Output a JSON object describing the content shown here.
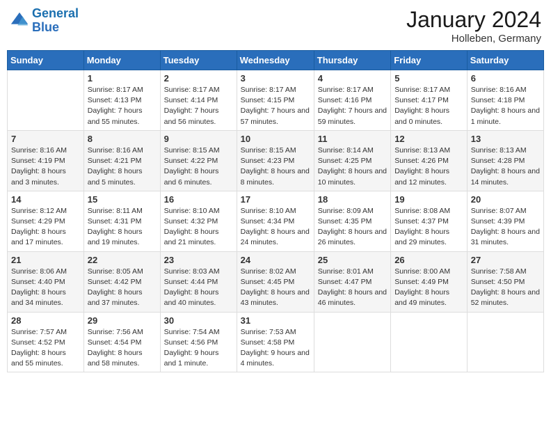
{
  "header": {
    "logo_general": "General",
    "logo_blue": "Blue",
    "month": "January 2024",
    "location": "Holleben, Germany"
  },
  "days_of_week": [
    "Sunday",
    "Monday",
    "Tuesday",
    "Wednesday",
    "Thursday",
    "Friday",
    "Saturday"
  ],
  "weeks": [
    [
      {
        "day": "",
        "sunrise": "",
        "sunset": "",
        "daylight": ""
      },
      {
        "day": "1",
        "sunrise": "Sunrise: 8:17 AM",
        "sunset": "Sunset: 4:13 PM",
        "daylight": "Daylight: 7 hours and 55 minutes."
      },
      {
        "day": "2",
        "sunrise": "Sunrise: 8:17 AM",
        "sunset": "Sunset: 4:14 PM",
        "daylight": "Daylight: 7 hours and 56 minutes."
      },
      {
        "day": "3",
        "sunrise": "Sunrise: 8:17 AM",
        "sunset": "Sunset: 4:15 PM",
        "daylight": "Daylight: 7 hours and 57 minutes."
      },
      {
        "day": "4",
        "sunrise": "Sunrise: 8:17 AM",
        "sunset": "Sunset: 4:16 PM",
        "daylight": "Daylight: 7 hours and 59 minutes."
      },
      {
        "day": "5",
        "sunrise": "Sunrise: 8:17 AM",
        "sunset": "Sunset: 4:17 PM",
        "daylight": "Daylight: 8 hours and 0 minutes."
      },
      {
        "day": "6",
        "sunrise": "Sunrise: 8:16 AM",
        "sunset": "Sunset: 4:18 PM",
        "daylight": "Daylight: 8 hours and 1 minute."
      }
    ],
    [
      {
        "day": "7",
        "sunrise": "Sunrise: 8:16 AM",
        "sunset": "Sunset: 4:19 PM",
        "daylight": "Daylight: 8 hours and 3 minutes."
      },
      {
        "day": "8",
        "sunrise": "Sunrise: 8:16 AM",
        "sunset": "Sunset: 4:21 PM",
        "daylight": "Daylight: 8 hours and 5 minutes."
      },
      {
        "day": "9",
        "sunrise": "Sunrise: 8:15 AM",
        "sunset": "Sunset: 4:22 PM",
        "daylight": "Daylight: 8 hours and 6 minutes."
      },
      {
        "day": "10",
        "sunrise": "Sunrise: 8:15 AM",
        "sunset": "Sunset: 4:23 PM",
        "daylight": "Daylight: 8 hours and 8 minutes."
      },
      {
        "day": "11",
        "sunrise": "Sunrise: 8:14 AM",
        "sunset": "Sunset: 4:25 PM",
        "daylight": "Daylight: 8 hours and 10 minutes."
      },
      {
        "day": "12",
        "sunrise": "Sunrise: 8:13 AM",
        "sunset": "Sunset: 4:26 PM",
        "daylight": "Daylight: 8 hours and 12 minutes."
      },
      {
        "day": "13",
        "sunrise": "Sunrise: 8:13 AM",
        "sunset": "Sunset: 4:28 PM",
        "daylight": "Daylight: 8 hours and 14 minutes."
      }
    ],
    [
      {
        "day": "14",
        "sunrise": "Sunrise: 8:12 AM",
        "sunset": "Sunset: 4:29 PM",
        "daylight": "Daylight: 8 hours and 17 minutes."
      },
      {
        "day": "15",
        "sunrise": "Sunrise: 8:11 AM",
        "sunset": "Sunset: 4:31 PM",
        "daylight": "Daylight: 8 hours and 19 minutes."
      },
      {
        "day": "16",
        "sunrise": "Sunrise: 8:10 AM",
        "sunset": "Sunset: 4:32 PM",
        "daylight": "Daylight: 8 hours and 21 minutes."
      },
      {
        "day": "17",
        "sunrise": "Sunrise: 8:10 AM",
        "sunset": "Sunset: 4:34 PM",
        "daylight": "Daylight: 8 hours and 24 minutes."
      },
      {
        "day": "18",
        "sunrise": "Sunrise: 8:09 AM",
        "sunset": "Sunset: 4:35 PM",
        "daylight": "Daylight: 8 hours and 26 minutes."
      },
      {
        "day": "19",
        "sunrise": "Sunrise: 8:08 AM",
        "sunset": "Sunset: 4:37 PM",
        "daylight": "Daylight: 8 hours and 29 minutes."
      },
      {
        "day": "20",
        "sunrise": "Sunrise: 8:07 AM",
        "sunset": "Sunset: 4:39 PM",
        "daylight": "Daylight: 8 hours and 31 minutes."
      }
    ],
    [
      {
        "day": "21",
        "sunrise": "Sunrise: 8:06 AM",
        "sunset": "Sunset: 4:40 PM",
        "daylight": "Daylight: 8 hours and 34 minutes."
      },
      {
        "day": "22",
        "sunrise": "Sunrise: 8:05 AM",
        "sunset": "Sunset: 4:42 PM",
        "daylight": "Daylight: 8 hours and 37 minutes."
      },
      {
        "day": "23",
        "sunrise": "Sunrise: 8:03 AM",
        "sunset": "Sunset: 4:44 PM",
        "daylight": "Daylight: 8 hours and 40 minutes."
      },
      {
        "day": "24",
        "sunrise": "Sunrise: 8:02 AM",
        "sunset": "Sunset: 4:45 PM",
        "daylight": "Daylight: 8 hours and 43 minutes."
      },
      {
        "day": "25",
        "sunrise": "Sunrise: 8:01 AM",
        "sunset": "Sunset: 4:47 PM",
        "daylight": "Daylight: 8 hours and 46 minutes."
      },
      {
        "day": "26",
        "sunrise": "Sunrise: 8:00 AM",
        "sunset": "Sunset: 4:49 PM",
        "daylight": "Daylight: 8 hours and 49 minutes."
      },
      {
        "day": "27",
        "sunrise": "Sunrise: 7:58 AM",
        "sunset": "Sunset: 4:50 PM",
        "daylight": "Daylight: 8 hours and 52 minutes."
      }
    ],
    [
      {
        "day": "28",
        "sunrise": "Sunrise: 7:57 AM",
        "sunset": "Sunset: 4:52 PM",
        "daylight": "Daylight: 8 hours and 55 minutes."
      },
      {
        "day": "29",
        "sunrise": "Sunrise: 7:56 AM",
        "sunset": "Sunset: 4:54 PM",
        "daylight": "Daylight: 8 hours and 58 minutes."
      },
      {
        "day": "30",
        "sunrise": "Sunrise: 7:54 AM",
        "sunset": "Sunset: 4:56 PM",
        "daylight": "Daylight: 9 hours and 1 minute."
      },
      {
        "day": "31",
        "sunrise": "Sunrise: 7:53 AM",
        "sunset": "Sunset: 4:58 PM",
        "daylight": "Daylight: 9 hours and 4 minutes."
      },
      {
        "day": "",
        "sunrise": "",
        "sunset": "",
        "daylight": ""
      },
      {
        "day": "",
        "sunrise": "",
        "sunset": "",
        "daylight": ""
      },
      {
        "day": "",
        "sunrise": "",
        "sunset": "",
        "daylight": ""
      }
    ]
  ]
}
